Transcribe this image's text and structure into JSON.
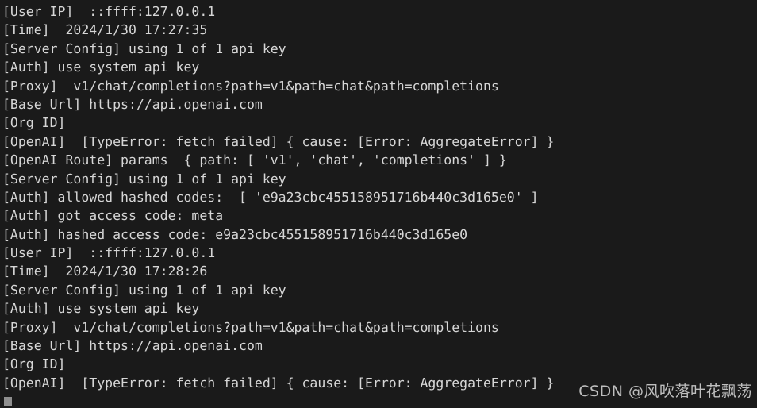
{
  "terminal": {
    "background_color": "#1a1a1a",
    "text_color": "#d6d6d6",
    "cursor_color": "#8f8f8f",
    "lines": [
      "[User IP]  ::ffff:127.0.0.1",
      "[Time]  2024/1/30 17:27:35",
      "[Server Config] using 1 of 1 api key",
      "[Auth] use system api key",
      "[Proxy]  v1/chat/completions?path=v1&path=chat&path=completions",
      "[Base Url] https://api.openai.com",
      "[Org ID]",
      "[OpenAI]  [TypeError: fetch failed] { cause: [Error: AggregateError] }",
      "[OpenAI Route] params  { path: [ 'v1', 'chat', 'completions' ] }",
      "[Server Config] using 1 of 1 api key",
      "[Auth] allowed hashed codes:  [ 'e9a23cbc455158951716b440c3d165e0' ]",
      "[Auth] got access code: meta",
      "[Auth] hashed access code: e9a23cbc455158951716b440c3d165e0",
      "[User IP]  ::ffff:127.0.0.1",
      "[Time]  2024/1/30 17:28:26",
      "[Server Config] using 1 of 1 api key",
      "[Auth] use system api key",
      "[Proxy]  v1/chat/completions?path=v1&path=chat&path=completions",
      "[Base Url] https://api.openai.com",
      "[Org ID]",
      "[OpenAI]  [TypeError: fetch failed] { cause: [Error: AggregateError] }"
    ]
  },
  "watermark": {
    "text": "CSDN @风吹落叶花飘荡",
    "color": "#e8e8e8"
  }
}
